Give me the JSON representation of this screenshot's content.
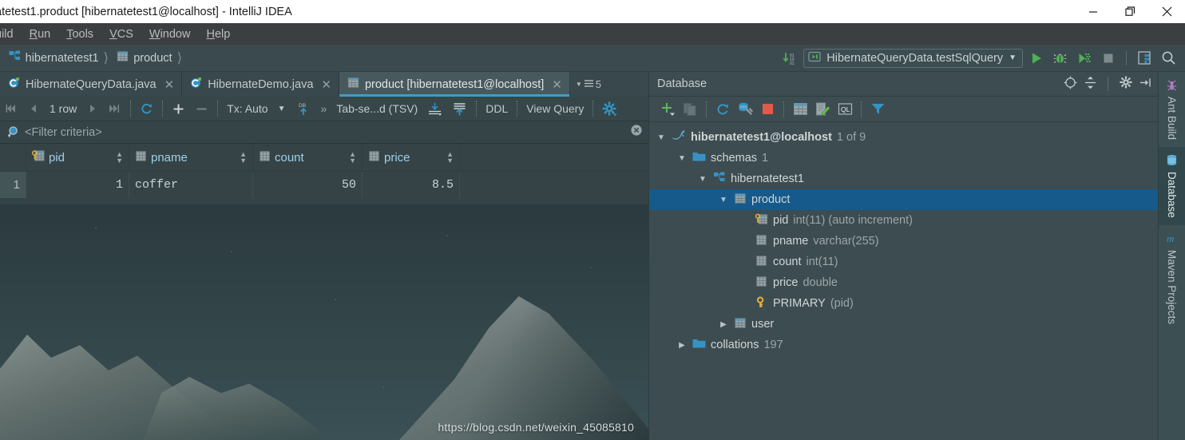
{
  "window": {
    "title": "atetest1.product [hibernatetest1@localhost] - IntelliJ IDEA",
    "minimize_label": "Minimize",
    "restore_label": "Restore",
    "close_label": "Close"
  },
  "menubar": {
    "items": [
      {
        "label": "uild",
        "mnemonic": ""
      },
      {
        "label": "Run",
        "mnemonic": "R"
      },
      {
        "label": "Tools",
        "mnemonic": "T"
      },
      {
        "label": "VCS",
        "mnemonic": "V"
      },
      {
        "label": "Window",
        "mnemonic": "W"
      },
      {
        "label": "Help",
        "mnemonic": "H"
      }
    ]
  },
  "navbar": {
    "breadcrumbs": [
      {
        "label": "hibernatetest1",
        "icon": "schema-icon"
      },
      {
        "label": "product",
        "icon": "table-icon"
      }
    ],
    "run_configuration": "HibernateQueryData.testSqlQuery",
    "buttons": [
      {
        "name": "update-running-application-icon",
        "label": "Update"
      },
      {
        "name": "run-icon",
        "label": "Run"
      },
      {
        "name": "debug-icon",
        "label": "Debug"
      },
      {
        "name": "run-with-coverage-icon",
        "label": "Run with Coverage"
      },
      {
        "name": "stop-icon",
        "label": "Stop"
      },
      {
        "name": "layout-icon",
        "label": "Layout"
      },
      {
        "name": "search-icon",
        "label": "Search Everywhere"
      }
    ]
  },
  "editor_tabs": {
    "tabs": [
      {
        "label": "HibernateQueryData.java",
        "icon": "java-class-icon",
        "active": false
      },
      {
        "label": "HibernateDemo.java",
        "icon": "java-class-icon",
        "active": false
      },
      {
        "label": "product [hibernatetest1@localhost]",
        "icon": "table-icon",
        "active": true
      }
    ],
    "overflow_count": "5"
  },
  "grid_toolbar": {
    "first_label": "First row",
    "prev_label": "Previous row",
    "row_count": "1 row",
    "next_label": "Next row",
    "last_label": "Last row",
    "reload_label": "Reload page",
    "add_label": "Add new row",
    "remove_label": "Delete row",
    "tx_label": "Tx: Auto",
    "db_upload_label": "Submit to database",
    "expand_label": "Expand",
    "format_label": "Tab-se...d (TSV)",
    "export_label": "Export Data",
    "import_label": "Import Data",
    "ddl_label": "DDL",
    "view_query_label": "View Query",
    "settings_label": "Data Source Properties"
  },
  "filter_bar": {
    "placeholder": "<Filter criteria>",
    "value": "",
    "clear_label": "Clear filter"
  },
  "result_grid": {
    "columns": [
      {
        "name": "pid",
        "icon": "primary-key-column-icon",
        "align": "right"
      },
      {
        "name": "pname",
        "icon": "column-icon",
        "align": "left"
      },
      {
        "name": "count",
        "icon": "column-icon",
        "align": "right"
      },
      {
        "name": "price",
        "icon": "column-icon",
        "align": "right"
      }
    ],
    "rows": [
      {
        "num": "1",
        "pid": "1",
        "pname": "coffer",
        "count": "50",
        "price": "8.5"
      }
    ]
  },
  "database_panel": {
    "title": "Database",
    "header_buttons": [
      {
        "name": "scroll-from-source-icon",
        "label": "Scroll from Source"
      },
      {
        "name": "collapse-all-icon",
        "label": "Collapse All"
      },
      {
        "name": "settings-gear-icon",
        "label": "Settings"
      },
      {
        "name": "hide-icon",
        "label": "Hide"
      }
    ],
    "toolbar_buttons": [
      {
        "name": "add-icon",
        "label": "New"
      },
      {
        "name": "copy-icon",
        "label": "Duplicate"
      },
      {
        "name": "refresh-icon",
        "label": "Refresh"
      },
      {
        "name": "datasource-properties-icon",
        "label": "Data Source Properties"
      },
      {
        "name": "stop-icon",
        "label": "Stop"
      },
      {
        "name": "jump-to-table-icon",
        "label": "Jump to Console"
      },
      {
        "name": "modify-table-icon",
        "label": "Modify Table"
      },
      {
        "name": "sql-console-icon",
        "label": "Open Console"
      },
      {
        "name": "filter-icon",
        "label": "Filter"
      }
    ],
    "tree": [
      {
        "depth": 0,
        "expanded": true,
        "icon": "mysql-icon",
        "label": "hibernatetest1@localhost",
        "meta": "1 of 9",
        "bold": true,
        "selected": false
      },
      {
        "depth": 1,
        "expanded": true,
        "icon": "folder-icon",
        "label": "schemas",
        "meta": "1",
        "bold": false,
        "selected": false
      },
      {
        "depth": 2,
        "expanded": true,
        "icon": "schema-icon",
        "label": "hibernatetest1",
        "meta": "",
        "bold": false,
        "selected": false
      },
      {
        "depth": 3,
        "expanded": true,
        "icon": "table-icon",
        "label": "product",
        "meta": "",
        "bold": false,
        "selected": true
      },
      {
        "depth": 4,
        "expanded": null,
        "icon": "primary-key-column-icon",
        "label": "pid",
        "meta": "int(11) (auto increment)",
        "bold": false,
        "selected": false
      },
      {
        "depth": 4,
        "expanded": null,
        "icon": "column-icon",
        "label": "pname",
        "meta": "varchar(255)",
        "bold": false,
        "selected": false
      },
      {
        "depth": 4,
        "expanded": null,
        "icon": "column-icon",
        "label": "count",
        "meta": "int(11)",
        "bold": false,
        "selected": false
      },
      {
        "depth": 4,
        "expanded": null,
        "icon": "column-icon",
        "label": "price",
        "meta": "double",
        "bold": false,
        "selected": false
      },
      {
        "depth": 4,
        "expanded": null,
        "icon": "key-icon",
        "label": "PRIMARY",
        "meta": "(pid)",
        "bold": false,
        "selected": false
      },
      {
        "depth": 3,
        "expanded": false,
        "icon": "table-icon",
        "label": "user",
        "meta": "",
        "bold": false,
        "selected": false
      },
      {
        "depth": 2,
        "expanded": false,
        "icon": "folder-icon",
        "label": "collations",
        "meta": "197",
        "bold": false,
        "selected": false
      }
    ]
  },
  "right_tool_strip": {
    "tabs": [
      {
        "label": "Ant Build",
        "icon": "ant-icon",
        "active": false
      },
      {
        "label": "Database",
        "icon": "database-icon",
        "active": true
      },
      {
        "label": "Maven Projects",
        "icon": "maven-icon",
        "active": false
      }
    ]
  },
  "watermark": {
    "text": "https://blog.csdn.net/weixin_45085810"
  },
  "colors": {
    "accent_blue": "#3d9ec9",
    "selection_blue": "#155a8a",
    "run_green": "#4caf50",
    "stop_red": "#e05b4a",
    "key_gold": "#e0b13c",
    "titlebar_bg": "#ffffff",
    "menubar_bg": "#3c3f41"
  }
}
